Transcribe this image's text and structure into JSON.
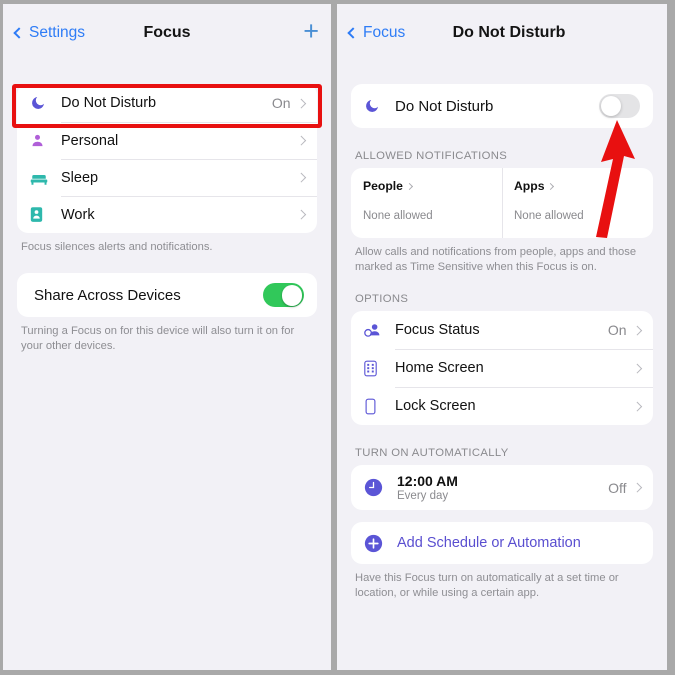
{
  "left_panel": {
    "nav": {
      "back_label": "Settings",
      "title": "Focus",
      "add_icon": "plus-icon"
    },
    "focus_list": [
      {
        "label": "Do Not Disturb",
        "value": "On",
        "icon": "moon-icon",
        "icon_color": "#5b55d6"
      },
      {
        "label": "Personal",
        "value": "",
        "icon": "person-icon",
        "icon_color": "#b05fd8"
      },
      {
        "label": "Sleep",
        "value": "",
        "icon": "bed-icon",
        "icon_color": "#2eb8ac"
      },
      {
        "label": "Work",
        "value": "",
        "icon": "id-card-icon",
        "icon_color": "#2eb8ac"
      }
    ],
    "focus_footnote": "Focus silences alerts and notifications.",
    "share": {
      "label": "Share Across Devices",
      "toggle_state": "on",
      "footnote": "Turning a Focus on for this device will also turn it on for your other devices."
    }
  },
  "right_panel": {
    "nav": {
      "back_label": "Focus",
      "title": "Do Not Disturb"
    },
    "main_toggle": {
      "label": "Do Not Disturb",
      "icon": "moon-icon",
      "toggle_state": "off"
    },
    "allowed_notifications": {
      "header": "ALLOWED NOTIFICATIONS",
      "columns": [
        {
          "title": "People",
          "subtitle": "None allowed"
        },
        {
          "title": "Apps",
          "subtitle": "None allowed"
        }
      ],
      "footnote": "Allow calls and notifications from people, apps and those marked as Time Sensitive when this Focus is on."
    },
    "options": {
      "header": "OPTIONS",
      "rows": [
        {
          "label": "Focus Status",
          "value": "On",
          "icon": "focus-status-icon"
        },
        {
          "label": "Home Screen",
          "value": "",
          "icon": "home-screen-icon"
        },
        {
          "label": "Lock Screen",
          "value": "",
          "icon": "lock-screen-icon"
        }
      ]
    },
    "automation": {
      "header": "TURN ON AUTOMATICALLY",
      "schedule": {
        "time": "12:00 AM",
        "repeat": "Every day",
        "value": "Off",
        "icon": "clock-icon"
      },
      "add_label": "Add Schedule or Automation",
      "add_icon": "plus-circle-icon",
      "footnote": "Have this Focus turn on automatically at a set time or location, or while using a certain app."
    }
  },
  "annotations": {
    "highlight_target": "do-not-disturb-row",
    "arrow_target": "do-not-disturb-toggle",
    "color": "#e81010"
  }
}
